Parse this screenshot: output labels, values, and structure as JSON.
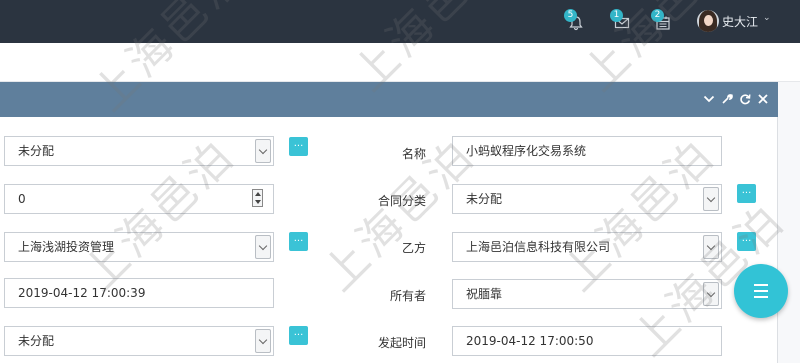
{
  "topbar": {
    "notifications": {
      "count": "5",
      "icon": "bell-icon"
    },
    "messages": {
      "count": "1",
      "icon": "envelope-icon"
    },
    "tasks": {
      "count": "2",
      "icon": "calendar-icon"
    },
    "user": {
      "name": "史大江",
      "caret": "⌄"
    }
  },
  "panel": {
    "controls": {
      "collapse": "⌄",
      "settings": "wrench-icon",
      "refresh": "refresh-icon",
      "close": "✕"
    }
  },
  "form": {
    "left": [
      {
        "value": "未分配",
        "type": "select",
        "has_picker": true
      },
      {
        "value": "0",
        "type": "number",
        "has_picker": false
      },
      {
        "value": "上海浅湖投资管理",
        "type": "select",
        "has_picker": true
      },
      {
        "value": "2019-04-12 17:00:39",
        "type": "text",
        "has_picker": false
      },
      {
        "value": "未分配",
        "type": "select",
        "has_picker": true
      }
    ],
    "right": [
      {
        "label": "名称",
        "value": "小蚂蚁程序化交易系统",
        "type": "text",
        "has_picker": false
      },
      {
        "label": "合同分类",
        "value": "未分配",
        "type": "select",
        "has_picker": true
      },
      {
        "label": "乙方",
        "value": "上海邑泊信息科技有限公司",
        "type": "select",
        "has_picker": true
      },
      {
        "label": "所有者",
        "value": "祝腼靠",
        "type": "select",
        "has_picker": false
      },
      {
        "label": "发起时间",
        "value": "2019-04-12 17:00:50",
        "type": "text",
        "has_picker": false
      }
    ],
    "picker_label": "..."
  },
  "watermark": "上海邑泊",
  "colors": {
    "topbar_bg": "#2b3440",
    "panel_header": "#5f7f9c",
    "accent": "#3ac3d6"
  }
}
